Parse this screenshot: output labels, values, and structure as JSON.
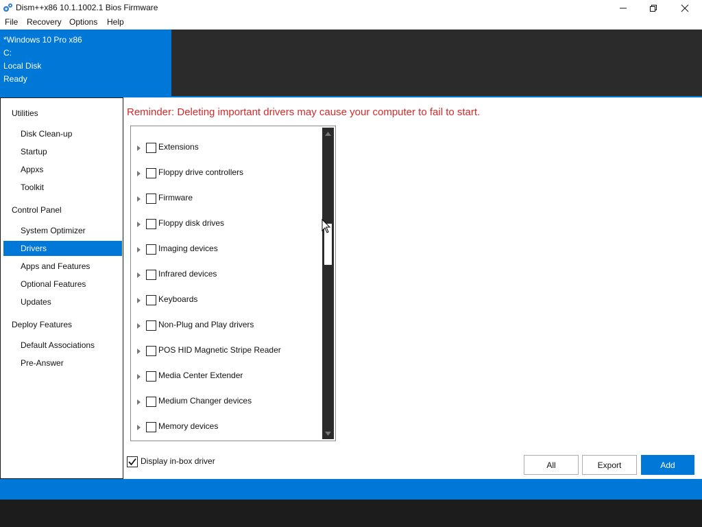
{
  "window": {
    "title": "Dism++x86 10.1.1002.1 Bios Firmware",
    "icon": "gear-icon"
  },
  "menu": [
    "File",
    "Recovery",
    "Options",
    "Help"
  ],
  "header": {
    "os_name": "*Windows 10 Pro x86",
    "drive": "C:",
    "disk_label": "Local Disk",
    "status": "Ready"
  },
  "sidebar": {
    "groups": [
      {
        "label": "Utilities",
        "items": [
          "Disk Clean-up",
          "Startup",
          "Appxs",
          "Toolkit"
        ]
      },
      {
        "label": "Control Panel",
        "items": [
          "System Optimizer",
          "Drivers",
          "Apps and Features",
          "Optional Features",
          "Updates"
        ]
      },
      {
        "label": "Deploy Features",
        "items": [
          "Default Associations",
          "Pre-Answer"
        ]
      }
    ],
    "selected": "Drivers"
  },
  "main": {
    "reminder": "Reminder: Deleting important drivers may cause your computer to fail to start.",
    "drivers": [
      "Extensions",
      "Floppy drive controllers",
      "Firmware",
      "Floppy disk drives",
      "Imaging devices",
      "Infrared devices",
      "Keyboards",
      "Non-Plug and Play drivers",
      "POS HID Magnetic Stripe Reader",
      "Media Center Extender",
      "Medium Changer devices",
      "Memory devices"
    ],
    "display_inbox_label": "Display in-box driver",
    "display_inbox_checked": true,
    "buttons": {
      "all": "All",
      "export": "Export",
      "add": "Add"
    }
  },
  "colors": {
    "accent": "#0078d7",
    "dark": "#2b2b2b",
    "reminder": "#d42a2a"
  }
}
